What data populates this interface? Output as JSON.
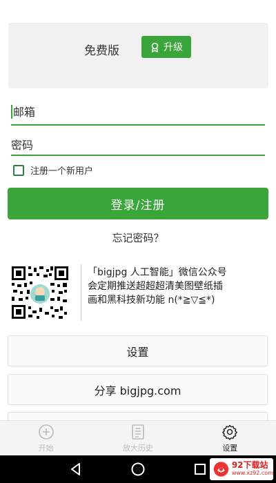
{
  "plan": {
    "label": "免费版",
    "upgrade_label": "升级"
  },
  "form": {
    "email_placeholder": "邮箱",
    "password_placeholder": "密码",
    "register_checkbox_label": "注册一个新用户",
    "submit_label": "登录/注册",
    "forgot_label": "忘记密码？"
  },
  "promo": {
    "line1": "「bigjpg 人工智能」微信公众号",
    "line2": "会定期推送超超超清美图壁纸插",
    "line3": "画和黑科技新功能 n(*≧▽≦*)"
  },
  "menu": {
    "settings_label": "设置",
    "share_label": "分享 bigjpg.com"
  },
  "nav": {
    "items": [
      {
        "label": "开始",
        "icon": "plus-circle-icon",
        "active": false
      },
      {
        "label": "放大历史",
        "icon": "history-list-icon",
        "active": false
      },
      {
        "label": "设置",
        "icon": "gear-icon",
        "active": true
      }
    ]
  },
  "system_bar": {
    "buttons": [
      "back-icon",
      "home-icon",
      "recents-icon"
    ]
  },
  "watermark": {
    "title": "92下载站",
    "subtitle": "www.xz92.com"
  },
  "colors": {
    "accent": "#3aa53a",
    "checkbox_border": "#2e7d4e",
    "inactive_nav": "#bbbbbb"
  }
}
